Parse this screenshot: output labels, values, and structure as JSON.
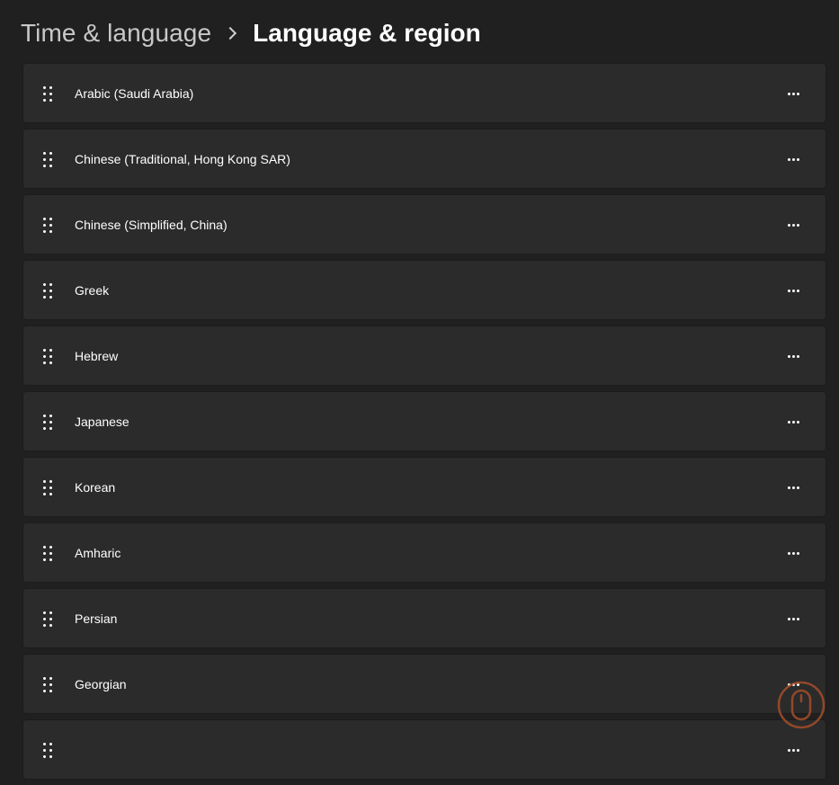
{
  "breadcrumb": {
    "parent": "Time & language",
    "current": "Language & region"
  },
  "languages": [
    {
      "label": "Arabic (Saudi Arabia)"
    },
    {
      "label": "Chinese (Traditional, Hong Kong SAR)"
    },
    {
      "label": "Chinese (Simplified, China)"
    },
    {
      "label": "Greek"
    },
    {
      "label": "Hebrew"
    },
    {
      "label": "Japanese"
    },
    {
      "label": "Korean"
    },
    {
      "label": "Amharic"
    },
    {
      "label": "Persian"
    },
    {
      "label": "Georgian"
    },
    {
      "label": ""
    }
  ],
  "icons": {
    "separator": "chevron-right-icon",
    "drag": "drag-handle-icon",
    "more": "more-options-icon"
  },
  "colors": {
    "background": "#202020",
    "card": "#2b2b2b",
    "text": "#ffffff",
    "breadcrumb_parent": "#c8c8c8",
    "watermark": "#b5532a"
  }
}
